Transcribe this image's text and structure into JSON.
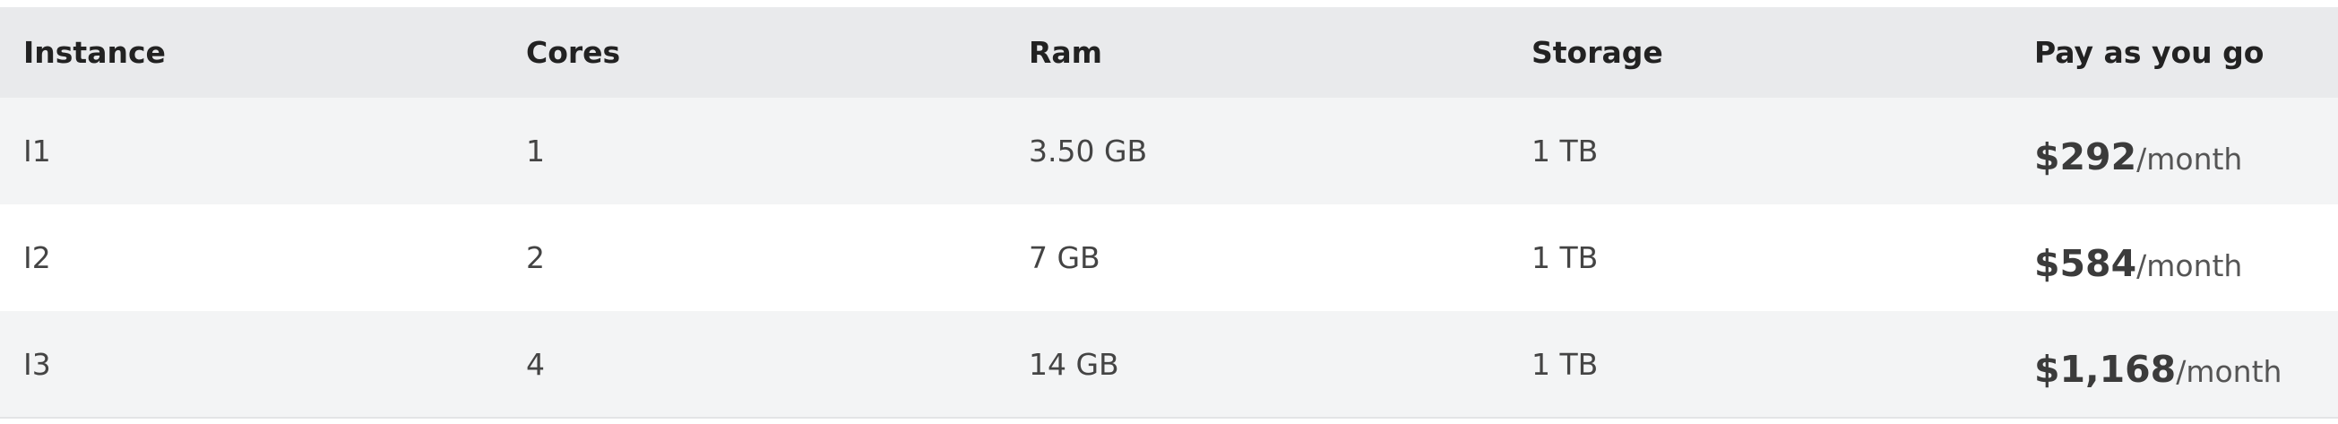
{
  "table": {
    "headers": {
      "instance": "Instance",
      "cores": "Cores",
      "ram": "Ram",
      "storage": "Storage",
      "price": "Pay as you go"
    },
    "rows": [
      {
        "instance": "I1",
        "cores": "1",
        "ram": "3.50 GB",
        "storage": "1 TB",
        "price_amount": "$292",
        "price_period": "/month"
      },
      {
        "instance": "I2",
        "cores": "2",
        "ram": "7 GB",
        "storage": "1 TB",
        "price_amount": "$584",
        "price_period": "/month"
      },
      {
        "instance": "I3",
        "cores": "4",
        "ram": "14 GB",
        "storage": "1 TB",
        "price_amount": "$1,168",
        "price_period": "/month"
      }
    ]
  },
  "colors": {
    "header_bg": "#e9eaec",
    "row_alt_bg": "#f3f4f5",
    "row_bg": "#ffffff"
  }
}
